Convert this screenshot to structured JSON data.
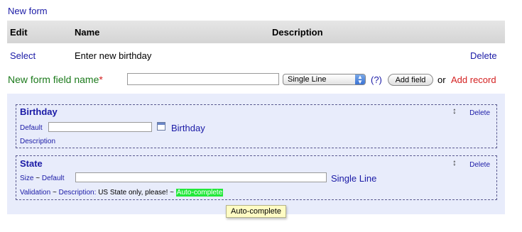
{
  "header": {
    "new_form_link": "New form"
  },
  "table": {
    "columns": [
      "Edit",
      "Name",
      "Description"
    ],
    "rows": [
      {
        "select_label": "Select",
        "name": "Enter new birthday",
        "delete_label": "Delete"
      }
    ]
  },
  "new_field": {
    "label": "New form field name",
    "required_marker": "*",
    "name_value": "",
    "type_selected": "Single Line",
    "help_label": "(?)",
    "add_field_label": "Add field",
    "or_text": "or",
    "add_record_label": "Add record"
  },
  "fields": [
    {
      "title": "Birthday",
      "default_label": "Default",
      "default_value": "",
      "type_label": "Birthday",
      "description_label": "Description",
      "delete_label": "Delete",
      "move_icon": "move-handle-icon",
      "calendar_icon": "calendar-icon"
    },
    {
      "title": "State",
      "size_label": "Size",
      "tilde": "~",
      "default_label": "Default",
      "default_value": "",
      "type_label": "Single Line",
      "validation_label": "Validation",
      "description_label": "Description:",
      "description_value": "US State only, please!",
      "autocomplete_label": "Auto-complete",
      "delete_label": "Delete",
      "move_icon": "move-handle-icon"
    }
  ],
  "tooltip": {
    "text": "Auto-complete"
  },
  "colors": {
    "link": "#1a1aa6",
    "label_green": "#1c7a1c",
    "add_record_red": "#d42020",
    "panel_bg": "#e8ecfb",
    "autocomplete_highlight": "#22e83a",
    "tooltip_bg": "#fffcc4"
  }
}
